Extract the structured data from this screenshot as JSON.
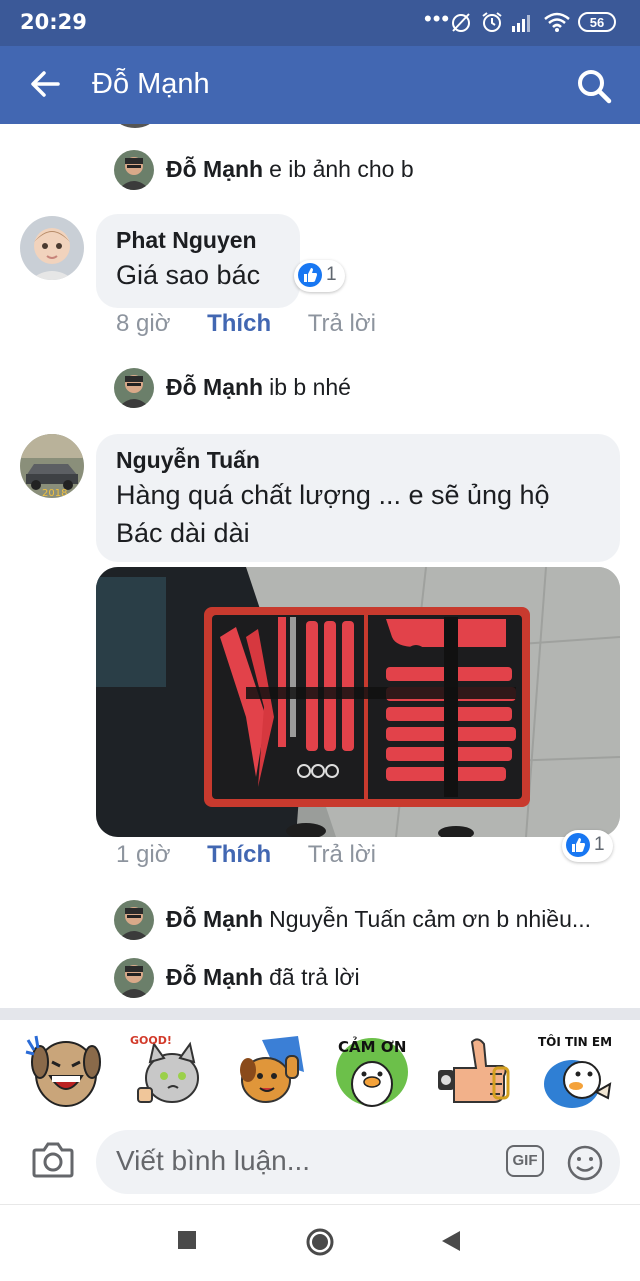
{
  "status_bar": {
    "time": "20:29",
    "dots": "•••",
    "battery": "56",
    "icons": [
      "alarm-off-icon",
      "alarm-icon",
      "signal-icon",
      "wifi-icon",
      "battery-icon"
    ]
  },
  "app_bar": {
    "title": "Đỗ Mạnh",
    "back_icon": "arrow-left-icon",
    "search_icon": "search-icon",
    "color": "#4267b2"
  },
  "thread": {
    "reply_1": {
      "name": "Đỗ Mạnh",
      "text": "e ib ảnh cho b"
    },
    "comment_1": {
      "name": "Phat Nguyen",
      "text": "Giá sao bác",
      "like_count": "1",
      "time": "8 giờ",
      "like_label": "Thích",
      "reply_label": "Trả lời"
    },
    "reply_2": {
      "name": "Đỗ Mạnh",
      "text": "ib b nhé"
    },
    "comment_2": {
      "name": "Nguyễn Tuấn",
      "text_line1": "Hàng quá chất lượng ... e sẽ ủng hộ",
      "text_line2": "Bác dài dài",
      "like_count": "1",
      "time": "1 giờ",
      "like_label": "Thích",
      "reply_label": "Trả lời"
    },
    "reply_3": {
      "name": "Đỗ Mạnh",
      "text": "Nguyễn Tuấn cảm ơn b nhiều..."
    },
    "reply_4": {
      "name": "Đỗ Mạnh",
      "text": "đã trả lời"
    }
  },
  "stickers": [
    "laughing-dog-sticker",
    "good-cat-sticker",
    "thumbs-up-dog-sticker",
    "cam-on-sticker",
    "thumbs-up-hand-sticker",
    "toi-tin-em-sticker"
  ],
  "sticker_text": {
    "good": "GOOD!",
    "cam_on": "CẢM ƠN",
    "toi_tin_em": "TÔI TIN EM"
  },
  "composer": {
    "placeholder": "Viết bình luận...",
    "gif_label": "GIF"
  },
  "nav": [
    "recents-square-icon",
    "home-circle-icon",
    "back-triangle-icon"
  ],
  "colors": {
    "facebook_blue": "#4267b2",
    "like_blue": "#1877f2",
    "bubble_gray": "#f0f2f5"
  }
}
